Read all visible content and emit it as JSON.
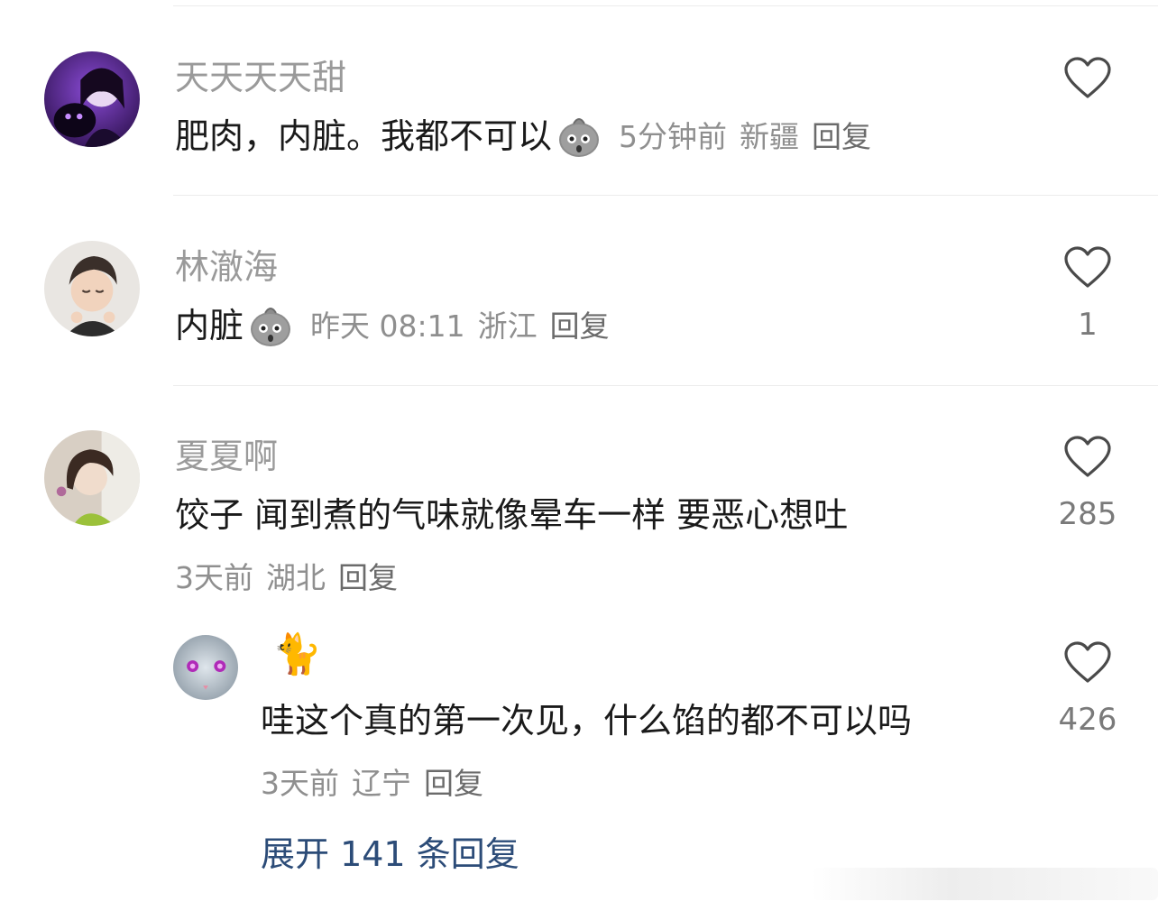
{
  "comments": [
    {
      "username": "天天天天甜",
      "content": "肥肉，内脏。我都不可以",
      "emoji": "potato-face-emoji",
      "time": "5分钟前",
      "location": "新疆",
      "reply": "回复",
      "likes": ""
    },
    {
      "username": "林澈海",
      "content": "内脏",
      "emoji": "potato-face-emoji",
      "time": "昨天 08:11",
      "location": "浙江",
      "reply": "回复",
      "likes": "1"
    },
    {
      "username": "夏夏啊",
      "content": "饺子 闻到煮的气味就像晕车一样 要恶心想吐",
      "time": "3天前",
      "location": "湖北",
      "reply": "回复",
      "likes": "285"
    }
  ],
  "sub_reply": {
    "username": "🐈",
    "content": "哇这个真的第一次见，什么馅的都不可以吗",
    "time": "3天前",
    "location": "辽宁",
    "reply": "回复",
    "likes": "426"
  },
  "expand_replies": "展开 141 条回复",
  "colors": {
    "text": "#1a1a1a",
    "meta": "#8f8f8f",
    "expand_link": "#2c4c78"
  }
}
